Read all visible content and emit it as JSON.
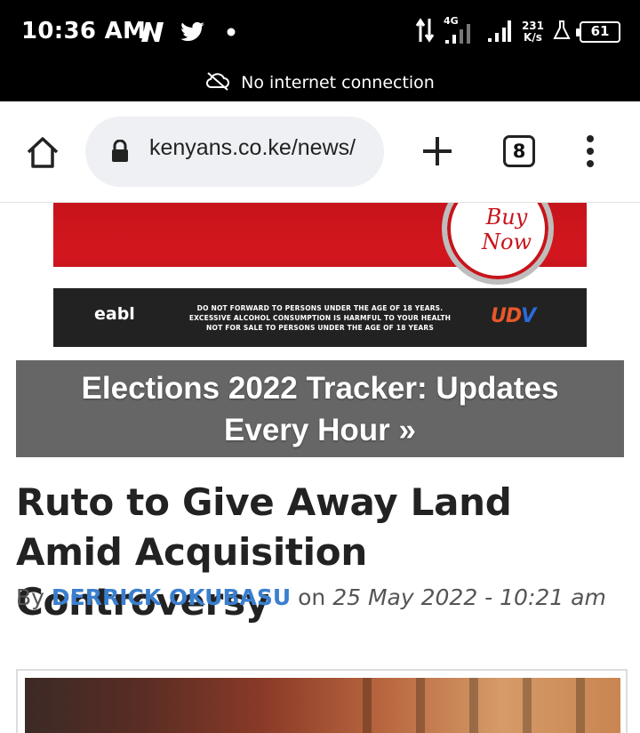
{
  "status_bar": {
    "time": "10:36 AM",
    "network_type": "4G",
    "net_speed_value": "231",
    "net_speed_unit": "K/s",
    "battery_level": "61",
    "icons": [
      "netflix-n-icon",
      "twitter-icon",
      "notification-dot-icon",
      "data-arrows-icon",
      "signal-icon",
      "signal-icon",
      "lab-flask-icon",
      "battery-icon"
    ]
  },
  "offline_banner": {
    "text": "No internet connection",
    "icon": "cloud-off-icon"
  },
  "toolbar": {
    "url": "kenyans.co.ke/news/",
    "tab_count": "8",
    "icons": [
      "home-icon",
      "lock-icon",
      "plus-icon",
      "tab-switcher-icon",
      "more-vert-icon"
    ]
  },
  "ad": {
    "cta_line1": "Buy",
    "cta_line2": "Now",
    "brand": "eabl",
    "warning_line1": "DO NOT FORWARD TO PERSONS UNDER THE AGE OF 18 YEARS.",
    "warning_line2": "EXCESSIVE ALCOHOL CONSUMPTION IS HARMFUL TO YOUR HEALTH",
    "warning_line3": "NOT FOR SALE TO PERSONS UNDER THE AGE OF 18 YEARS",
    "logo_ud": "UD",
    "logo_v": "V"
  },
  "tracker_banner": {
    "text": "Elections 2022 Tracker: Updates Every Hour »"
  },
  "article": {
    "headline": "Ruto to Give Away Land Amid Acquisition Controversy",
    "by_label": "By",
    "author": "DERRICK OKUBASU",
    "on_label": "on",
    "date": "25 May 2022 - 10:21 am"
  },
  "colors": {
    "status_bar_bg": "#000000",
    "author_link": "#3a7fcf",
    "tracker_bg": "#666666",
    "ad_red": "#c7141b"
  }
}
